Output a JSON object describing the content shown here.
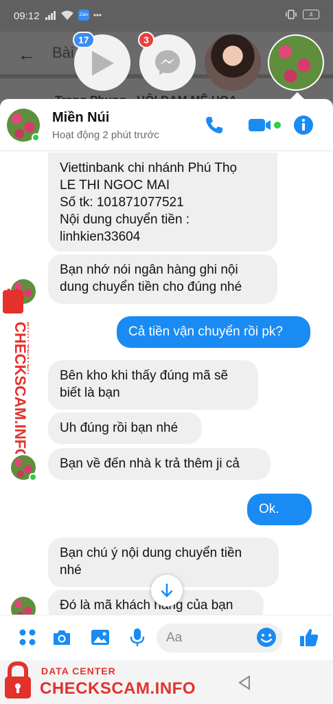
{
  "status_bar": {
    "time": "09:12",
    "battery": "4",
    "zalo": "Zalo"
  },
  "background_page": {
    "title": "Bài",
    "post_author": "Trang Phung",
    "post_group": "HỘI ĐAM MÊ HOA"
  },
  "chat_heads": [
    {
      "name": "video-head",
      "badge": "17"
    },
    {
      "name": "messenger-head",
      "badge": "3"
    },
    {
      "name": "girl-head",
      "badge": ""
    },
    {
      "name": "flower-head",
      "badge": ""
    }
  ],
  "chat": {
    "contact_name": "Miền Núi",
    "contact_status": "Hoạt động 2 phút trước",
    "colors": {
      "accent": "#1a8bf2",
      "incoming": "#efefef",
      "online": "#31cc46"
    },
    "messages": [
      {
        "direction": "in",
        "text": "Viettinbank chi nhánh Phú Thọ\nLE THI NGOC MAI\nSố tk: 101871077521\nNội dung chuyển tiền :\nlinhkien33604"
      },
      {
        "direction": "in",
        "text": "Bạn nhớ nói ngân hàng ghi nội\ndung chuyển tiền cho đúng nhé"
      },
      {
        "direction": "out",
        "text": "Cả tiền vận chuyển rồi pk?"
      },
      {
        "direction": "in",
        "text": "Bên kho khi thấy đúng mã sẽ\nbiết là bạn"
      },
      {
        "direction": "in",
        "text": "Uh đúng rồi bạn nhé"
      },
      {
        "direction": "in",
        "text": "Bạn về đến nhà k trả thêm ji cả"
      },
      {
        "direction": "out",
        "text": "Ok."
      },
      {
        "direction": "in",
        "text": "Bạn chú ý nội dung chuyển tiền\nnhé"
      },
      {
        "direction": "in",
        "text": "Đó là mã khách hàng của bạn"
      }
    ]
  },
  "composer": {
    "placeholder": "Aa"
  },
  "watermark": {
    "small": "DATA CENTER",
    "big": "CHECKSCAM.INFO"
  }
}
